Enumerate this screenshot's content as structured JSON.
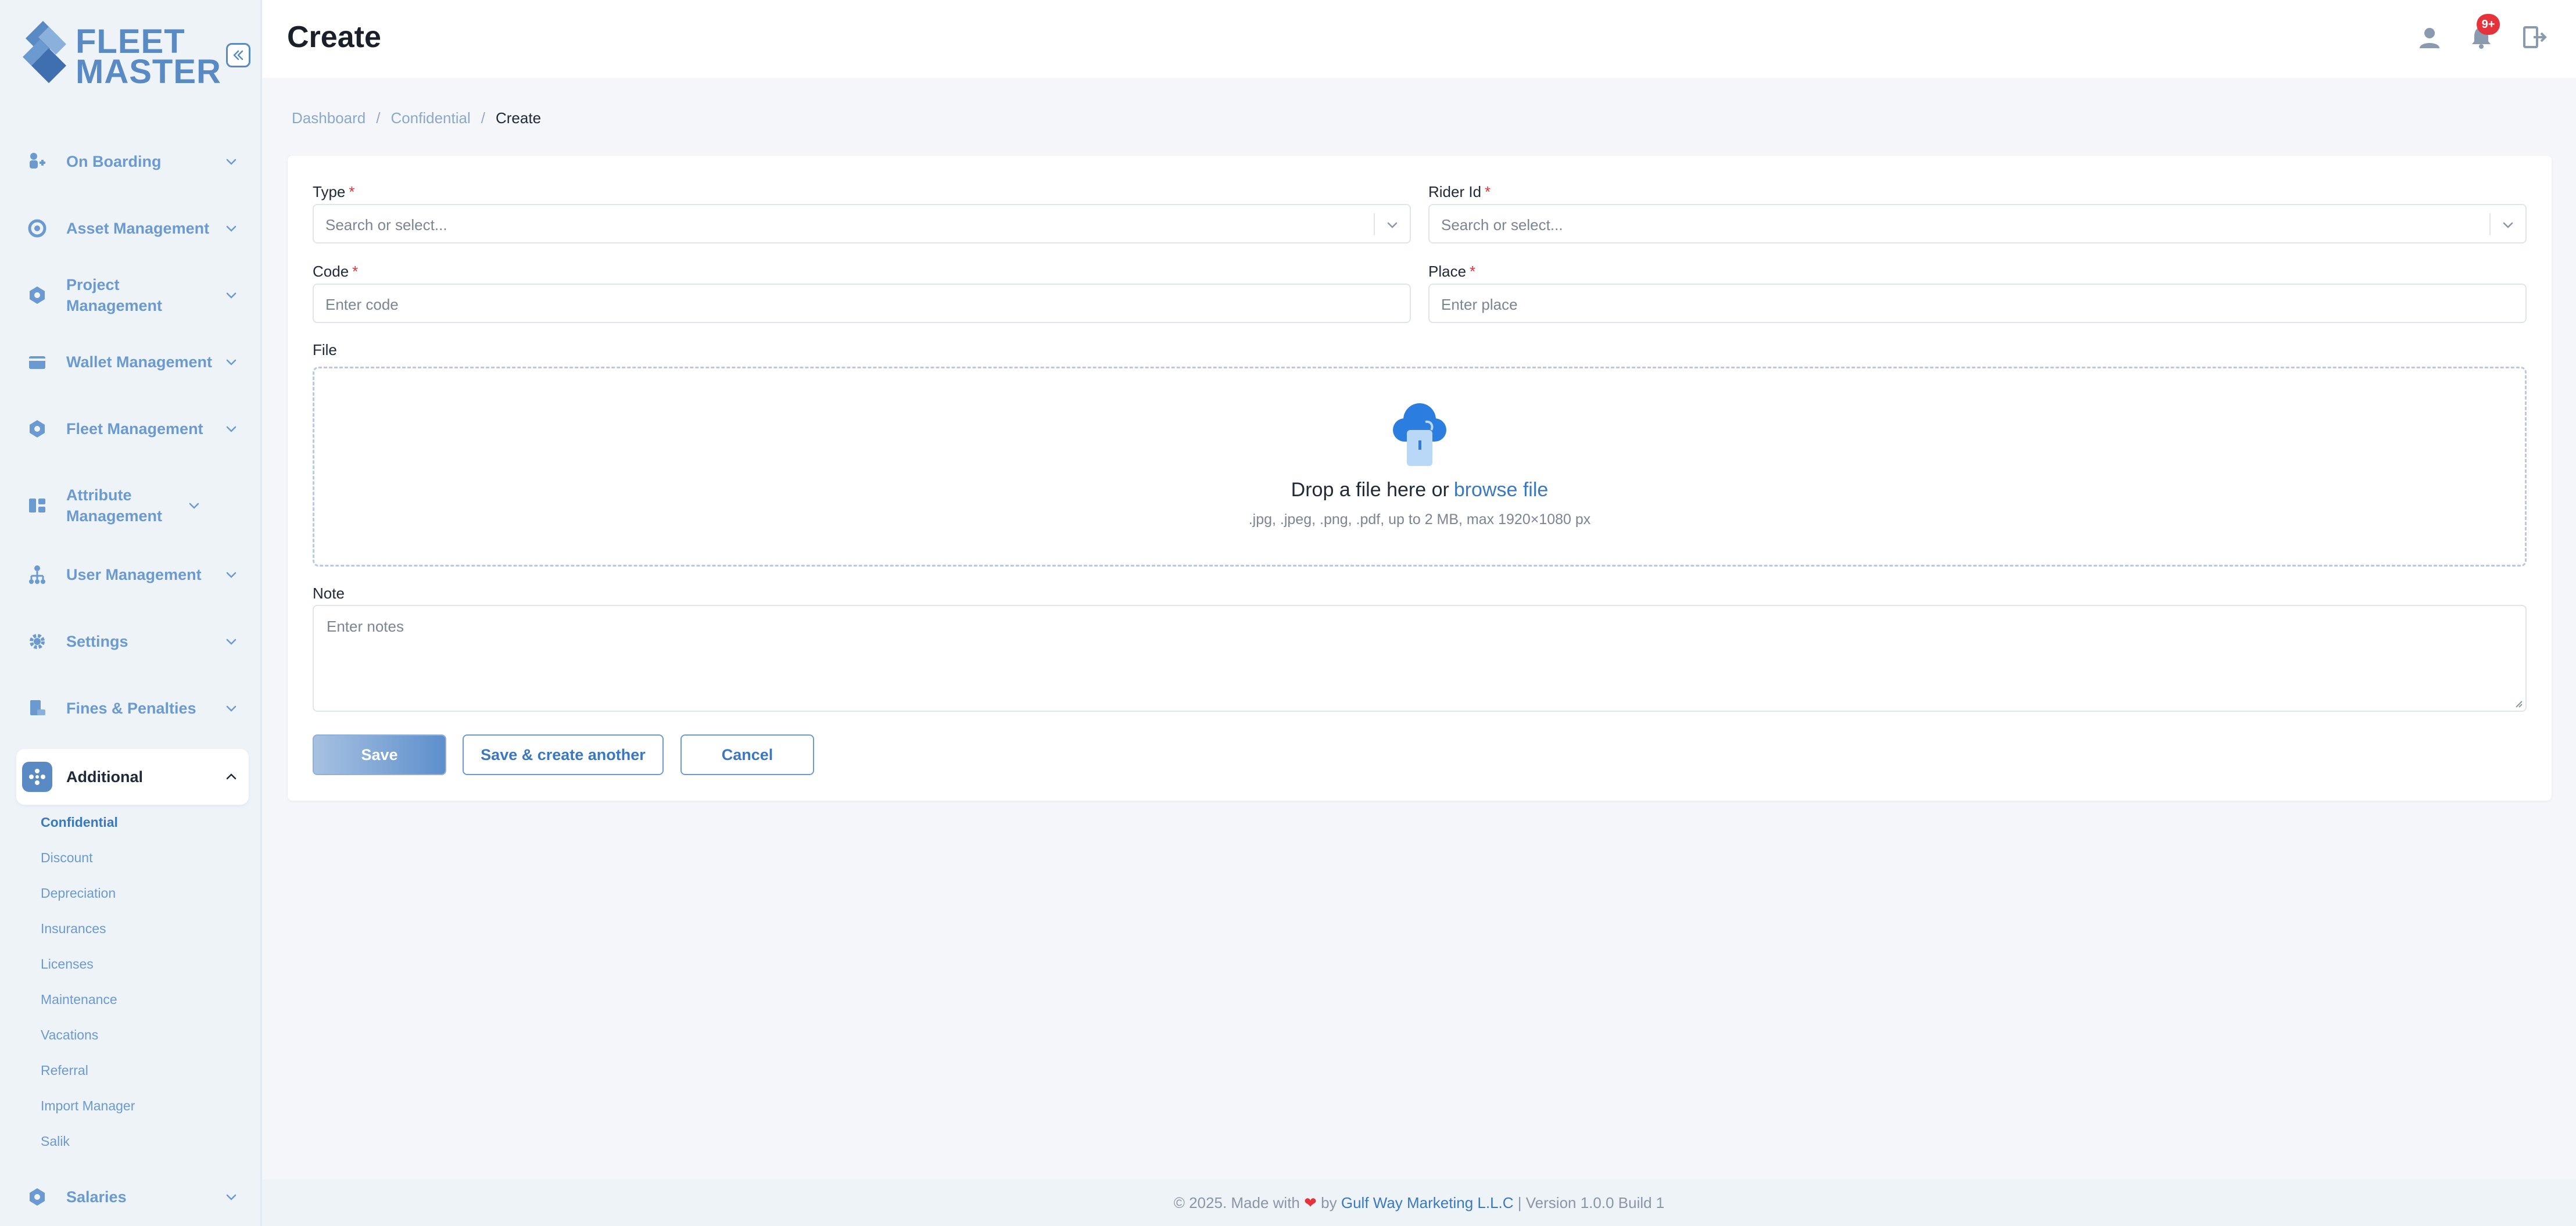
{
  "brand": {
    "line1": "FLEET",
    "line2": "MASTER",
    "color": "#5a8ac4"
  },
  "sidebar": {
    "collapse_icon": "double-chevron-left-icon",
    "items": [
      {
        "label": "On Boarding",
        "icon": "onboarding-icon"
      },
      {
        "label": "Asset Management",
        "icon": "asset-icon"
      },
      {
        "label": "Project Management",
        "icon": "project-icon"
      },
      {
        "label": "Wallet Management",
        "icon": "wallet-icon"
      },
      {
        "label": "Fleet Management",
        "icon": "fleet-icon"
      },
      {
        "label": "Attribute Management",
        "icon": "attribute-icon"
      },
      {
        "label": "User Management",
        "icon": "users-icon"
      },
      {
        "label": "Settings",
        "icon": "gear-icon"
      },
      {
        "label": "Fines & Penalties",
        "icon": "fines-icon"
      },
      {
        "label": "Additional",
        "icon": "additional-icon",
        "expanded": true
      },
      {
        "label": "Salaries",
        "icon": "salaries-icon"
      }
    ],
    "sub_items": [
      "Confidential",
      "Discount",
      "Depreciation",
      "Insurances",
      "Licenses",
      "Maintenance",
      "Vacations",
      "Referral",
      "Import Manager",
      "Salik"
    ],
    "active_sub": "Confidential"
  },
  "header": {
    "title": "Create",
    "notification_badge": "9+"
  },
  "breadcrumb": [
    "Dashboard",
    "Confidential",
    "Create"
  ],
  "form": {
    "type": {
      "label": "Type",
      "required": "*",
      "placeholder": "Search or select..."
    },
    "rider_id": {
      "label": "Rider Id",
      "required": "*",
      "placeholder": "Search or select..."
    },
    "code": {
      "label": "Code",
      "required": "*",
      "placeholder": "Enter code"
    },
    "place": {
      "label": "Place",
      "required": "*",
      "placeholder": "Enter place"
    },
    "file": {
      "label": "File",
      "drop_text": "Drop a file here or",
      "browse_text": "browse file",
      "hint": ".jpg, .jpeg, .png, .pdf, up to 2 MB, max 1920×1080 px"
    },
    "note": {
      "label": "Note",
      "placeholder": "Enter notes"
    },
    "buttons": {
      "save": "Save",
      "save_another": "Save & create another",
      "cancel": "Cancel"
    }
  },
  "footer": {
    "prefix": "© 2025. Made with",
    "by": "by",
    "company": "Gulf Way Marketing L.L.C",
    "version": "| Version 1.0.0 Build 1"
  }
}
